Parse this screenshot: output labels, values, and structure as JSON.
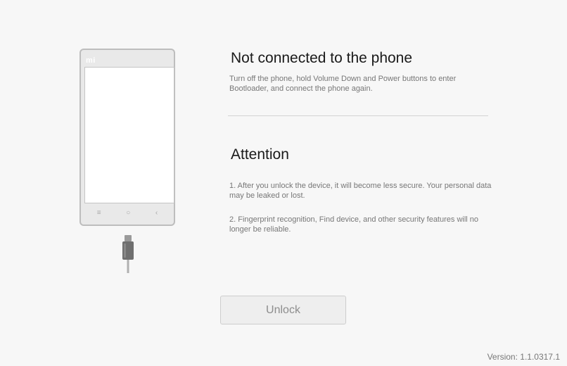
{
  "phone": {
    "logo_text": "mi",
    "nav_keys": [
      "≡",
      "○",
      "‹"
    ]
  },
  "connection": {
    "title": "Not connected to the phone",
    "description": "Turn off the phone, hold Volume Down and Power buttons to enter Bootloader, and connect the phone again."
  },
  "attention": {
    "title": "Attention",
    "items": [
      "1. After you unlock the device, it will become less secure. Your personal data may be leaked or lost.",
      "2. Fingerprint recognition, Find device, and other security features will no longer be reliable."
    ]
  },
  "actions": {
    "unlock_label": "Unlock"
  },
  "footer": {
    "version": "Version: 1.1.0317.1"
  },
  "icons": {
    "phone": "phone-illustration",
    "cable": "usb-cable-icon"
  },
  "colors": {
    "background": "#f7f7f7",
    "button_background": "#eeeeee",
    "button_text_disabled": "#8d8d8d",
    "title_text": "#1a1a1a",
    "body_text": "#777777"
  }
}
